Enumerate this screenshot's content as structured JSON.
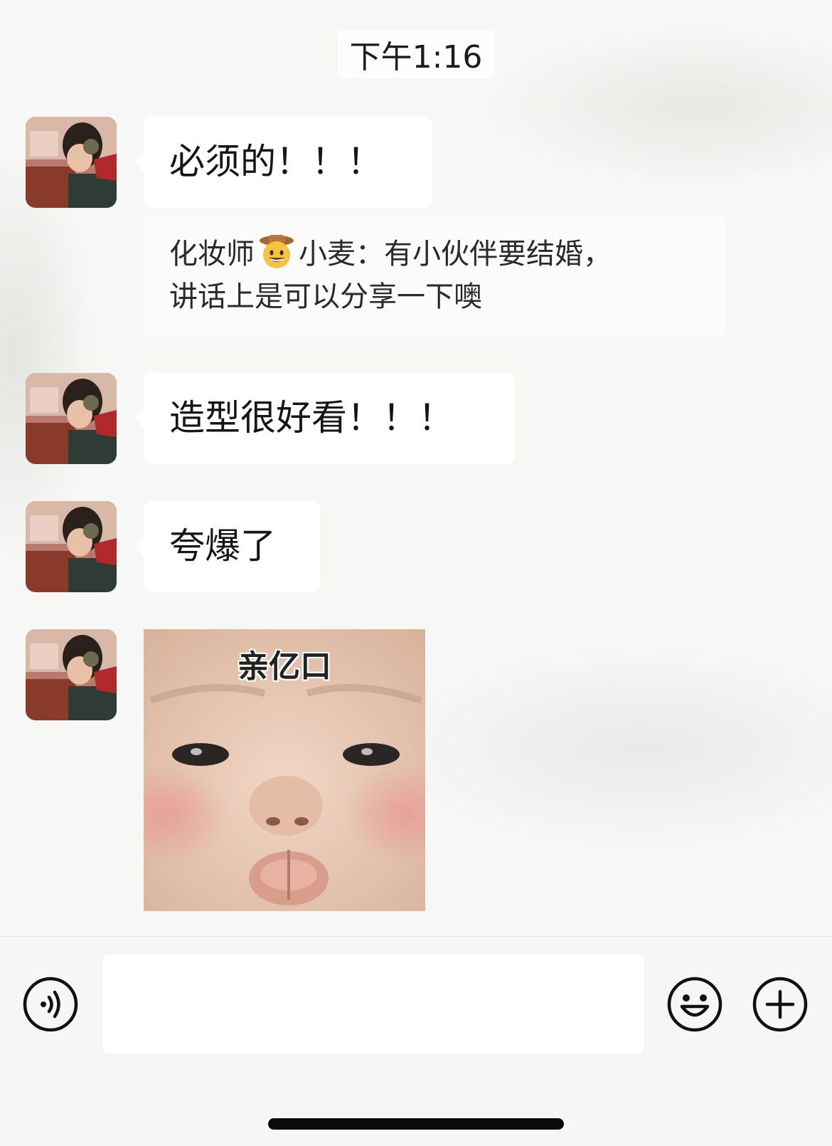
{
  "timestamp": "下午1:16",
  "messages": [
    {
      "text": "必须的！！！"
    },
    {
      "quote_prefix": "化妆师",
      "quote_emoji": "cowboy-hat-face",
      "quote_line1_rest": "小麦：有小伙伴要结婚，",
      "quote_line2": "讲话上是可以分享一下噢"
    },
    {
      "text": "造型很好看！！！"
    },
    {
      "text": "夸爆了"
    },
    {
      "sticker_caption": "亲亿口"
    }
  ],
  "input": {
    "value": "",
    "placeholder": ""
  },
  "icons": {
    "voice": "voice-input-icon",
    "emoji": "smiley-emoji-icon",
    "plus": "plus-icon"
  },
  "colors": {
    "bubble": "#ffffff",
    "background": "#f7f7f5",
    "text": "#151515"
  }
}
